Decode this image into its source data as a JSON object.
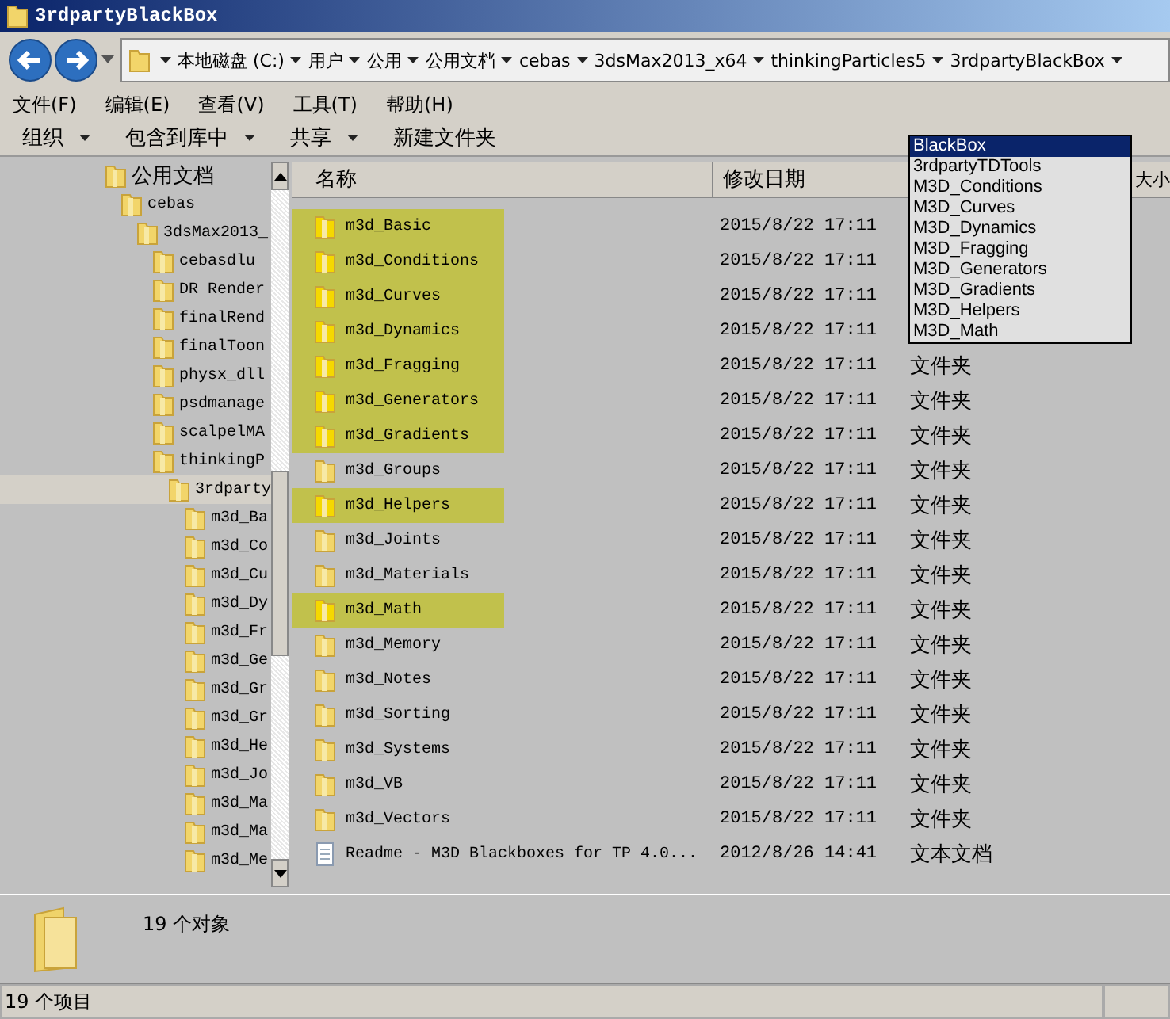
{
  "window": {
    "title": "3rdpartyBlackBox"
  },
  "address_bar": {
    "crumbs": [
      "本地磁盘 (C:)",
      "用户",
      "公用",
      "公用文档",
      "cebas",
      "3dsMax2013_x64",
      "thinkingParticles5",
      "3rdpartyBlackBox"
    ]
  },
  "menu_bar": [
    "文件(F)",
    "编辑(E)",
    "查看(V)",
    "工具(T)",
    "帮助(H)"
  ],
  "toolbar": [
    {
      "label": "组织",
      "dropdown": true
    },
    {
      "label": "包含到库中",
      "dropdown": true
    },
    {
      "label": "共享",
      "dropdown": true
    },
    {
      "label": "新建文件夹",
      "dropdown": false
    }
  ],
  "tree": [
    {
      "label": "公用文档",
      "selected": false,
      "children": [
        {
          "label": "cebas",
          "selected": false,
          "children": [
            {
              "label": "3dsMax2013_",
              "selected": false,
              "children": [
                {
                  "label": "cebasdlu",
                  "selected": false
                },
                {
                  "label": "DR Render",
                  "selected": false
                },
                {
                  "label": "finalRend",
                  "selected": false
                },
                {
                  "label": "finalToon",
                  "selected": false
                },
                {
                  "label": "physx_dll",
                  "selected": false
                },
                {
                  "label": "psdmanage",
                  "selected": false
                },
                {
                  "label": "scalpelMA",
                  "selected": false
                },
                {
                  "label": "thinkingP",
                  "selected": false,
                  "children": [
                    {
                      "label": "3rdparty",
                      "selected": true,
                      "children": [
                        {
                          "label": "m3d_Ba",
                          "selected": false
                        },
                        {
                          "label": "m3d_Co",
                          "selected": false
                        },
                        {
                          "label": "m3d_Cu",
                          "selected": false
                        },
                        {
                          "label": "m3d_Dy",
                          "selected": false
                        },
                        {
                          "label": "m3d_Fr",
                          "selected": false
                        },
                        {
                          "label": "m3d_Ge",
                          "selected": false
                        },
                        {
                          "label": "m3d_Gr",
                          "selected": false
                        },
                        {
                          "label": "m3d_Gr",
                          "selected": false
                        },
                        {
                          "label": "m3d_He",
                          "selected": false
                        },
                        {
                          "label": "m3d_Jo",
                          "selected": false
                        },
                        {
                          "label": "m3d_Ma",
                          "selected": false
                        },
                        {
                          "label": "m3d_Ma",
                          "selected": false
                        },
                        {
                          "label": "m3d_Me",
                          "selected": false
                        }
                      ]
                    }
                  ]
                }
              ]
            }
          ]
        }
      ]
    }
  ],
  "file_list": {
    "columns": [
      "名称",
      "修改日期",
      "大小"
    ],
    "rows": [
      {
        "name": "m3d_Basic",
        "date": "2015/8/22 17:11",
        "kind": "folder",
        "highlighted": true
      },
      {
        "name": "m3d_Conditions",
        "date": "2015/8/22 17:11",
        "kind": "folder",
        "highlighted": true
      },
      {
        "name": "m3d_Curves",
        "date": "2015/8/22 17:11",
        "kind": "folder",
        "highlighted": true
      },
      {
        "name": "m3d_Dynamics",
        "date": "2015/8/22 17:11",
        "kind": "folder",
        "highlighted": true
      },
      {
        "name": "m3d_Fragging",
        "date": "2015/8/22 17:11",
        "type": "文件夹",
        "kind": "folder",
        "highlighted": true
      },
      {
        "name": "m3d_Generators",
        "date": "2015/8/22 17:11",
        "type": "文件夹",
        "kind": "folder",
        "highlighted": true
      },
      {
        "name": "m3d_Gradients",
        "date": "2015/8/22 17:11",
        "type": "文件夹",
        "kind": "folder",
        "highlighted": true
      },
      {
        "name": "m3d_Groups",
        "date": "2015/8/22 17:11",
        "type": "文件夹",
        "kind": "folder",
        "highlighted": false
      },
      {
        "name": "m3d_Helpers",
        "date": "2015/8/22 17:11",
        "type": "文件夹",
        "kind": "folder",
        "highlighted": true
      },
      {
        "name": "m3d_Joints",
        "date": "2015/8/22 17:11",
        "type": "文件夹",
        "kind": "folder",
        "highlighted": false
      },
      {
        "name": "m3d_Materials",
        "date": "2015/8/22 17:11",
        "type": "文件夹",
        "kind": "folder",
        "highlighted": false
      },
      {
        "name": "m3d_Math",
        "date": "2015/8/22 17:11",
        "type": "文件夹",
        "kind": "folder",
        "highlighted": true
      },
      {
        "name": "m3d_Memory",
        "date": "2015/8/22 17:11",
        "type": "文件夹",
        "kind": "folder",
        "highlighted": false
      },
      {
        "name": "m3d_Notes",
        "date": "2015/8/22 17:11",
        "type": "文件夹",
        "kind": "folder",
        "highlighted": false
      },
      {
        "name": "m3d_Sorting",
        "date": "2015/8/22 17:11",
        "type": "文件夹",
        "kind": "folder",
        "highlighted": false
      },
      {
        "name": "m3d_Systems",
        "date": "2015/8/22 17:11",
        "type": "文件夹",
        "kind": "folder",
        "highlighted": false
      },
      {
        "name": "m3d_VB",
        "date": "2015/8/22 17:11",
        "type": "文件夹",
        "kind": "folder",
        "highlighted": false
      },
      {
        "name": "m3d_Vectors",
        "date": "2015/8/22 17:11",
        "type": "文件夹",
        "kind": "folder",
        "highlighted": false
      },
      {
        "name": "Readme - M3D Blackboxes for TP 4.0...",
        "date": "2012/8/26 14:41",
        "type": "文本文档",
        "kind": "text",
        "highlighted": false
      }
    ]
  },
  "dropdown_list": [
    {
      "label": "BlackBox",
      "selected": true
    },
    {
      "label": "3rdpartyTDTools",
      "selected": false
    },
    {
      "label": "M3D_Conditions",
      "selected": false
    },
    {
      "label": "M3D_Curves",
      "selected": false
    },
    {
      "label": "M3D_Dynamics",
      "selected": false
    },
    {
      "label": "M3D_Fragging",
      "selected": false
    },
    {
      "label": "M3D_Generators",
      "selected": false
    },
    {
      "label": "M3D_Gradients",
      "selected": false
    },
    {
      "label": "M3D_Helpers",
      "selected": false
    },
    {
      "label": "M3D_Math",
      "selected": false
    }
  ],
  "details_pane": {
    "count": "19 个对象"
  },
  "status_bar": {
    "text": "19 个项目"
  }
}
